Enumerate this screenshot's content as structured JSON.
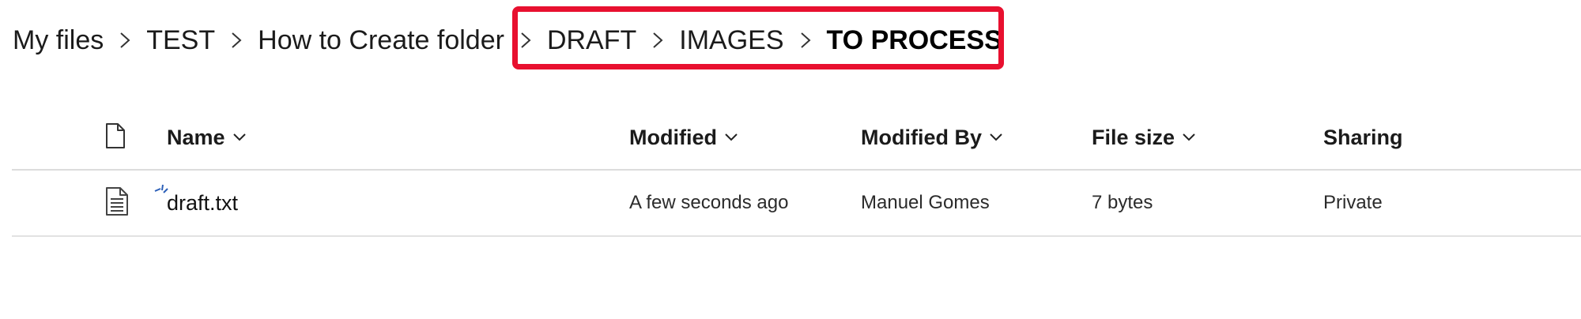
{
  "breadcrumb": {
    "items": [
      {
        "label": "My files"
      },
      {
        "label": "TEST"
      },
      {
        "label": "How to Create folder"
      },
      {
        "label": "DRAFT"
      },
      {
        "label": "IMAGES"
      },
      {
        "label": "TO PROCESS"
      }
    ],
    "highlight_color": "#e8102f"
  },
  "table": {
    "columns": {
      "type_icon": "document-icon",
      "name": "Name",
      "modified": "Modified",
      "modified_by": "Modified By",
      "file_size": "File size",
      "sharing": "Sharing"
    },
    "rows": [
      {
        "icon": "text-file-icon",
        "new_indicator": "new-item-icon",
        "name": "draft.txt",
        "modified": "A few seconds ago",
        "modified_by": "Manuel Gomes",
        "file_size": "7 bytes",
        "sharing": "Private"
      }
    ]
  }
}
